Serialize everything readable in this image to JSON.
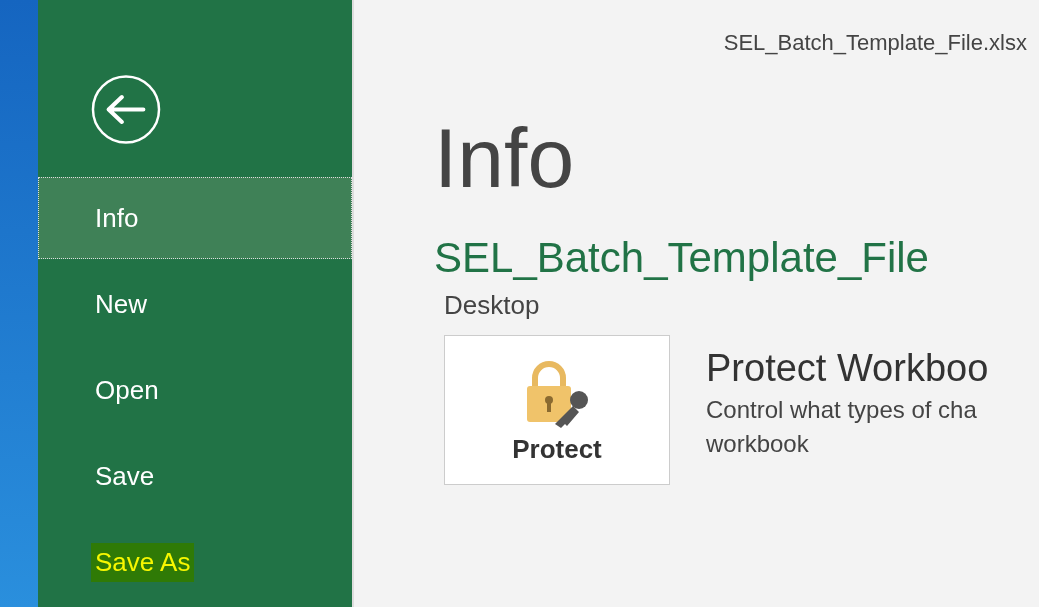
{
  "file_name": "SEL_Batch_Template_File.xlsx",
  "sidebar": {
    "items": [
      {
        "label": "Info",
        "selected": true,
        "highlighted": false
      },
      {
        "label": "New",
        "selected": false,
        "highlighted": false
      },
      {
        "label": "Open",
        "selected": false,
        "highlighted": false
      },
      {
        "label": "Save",
        "selected": false,
        "highlighted": false
      },
      {
        "label": "Save As",
        "selected": false,
        "highlighted": true
      }
    ]
  },
  "heading": "Info",
  "document": {
    "title": "SEL_Batch_Template_File",
    "location": "Desktop"
  },
  "protect": {
    "button_label": "Protect",
    "title": "Protect Workboo",
    "description": "Control what types of cha",
    "description_2": "workbook"
  }
}
